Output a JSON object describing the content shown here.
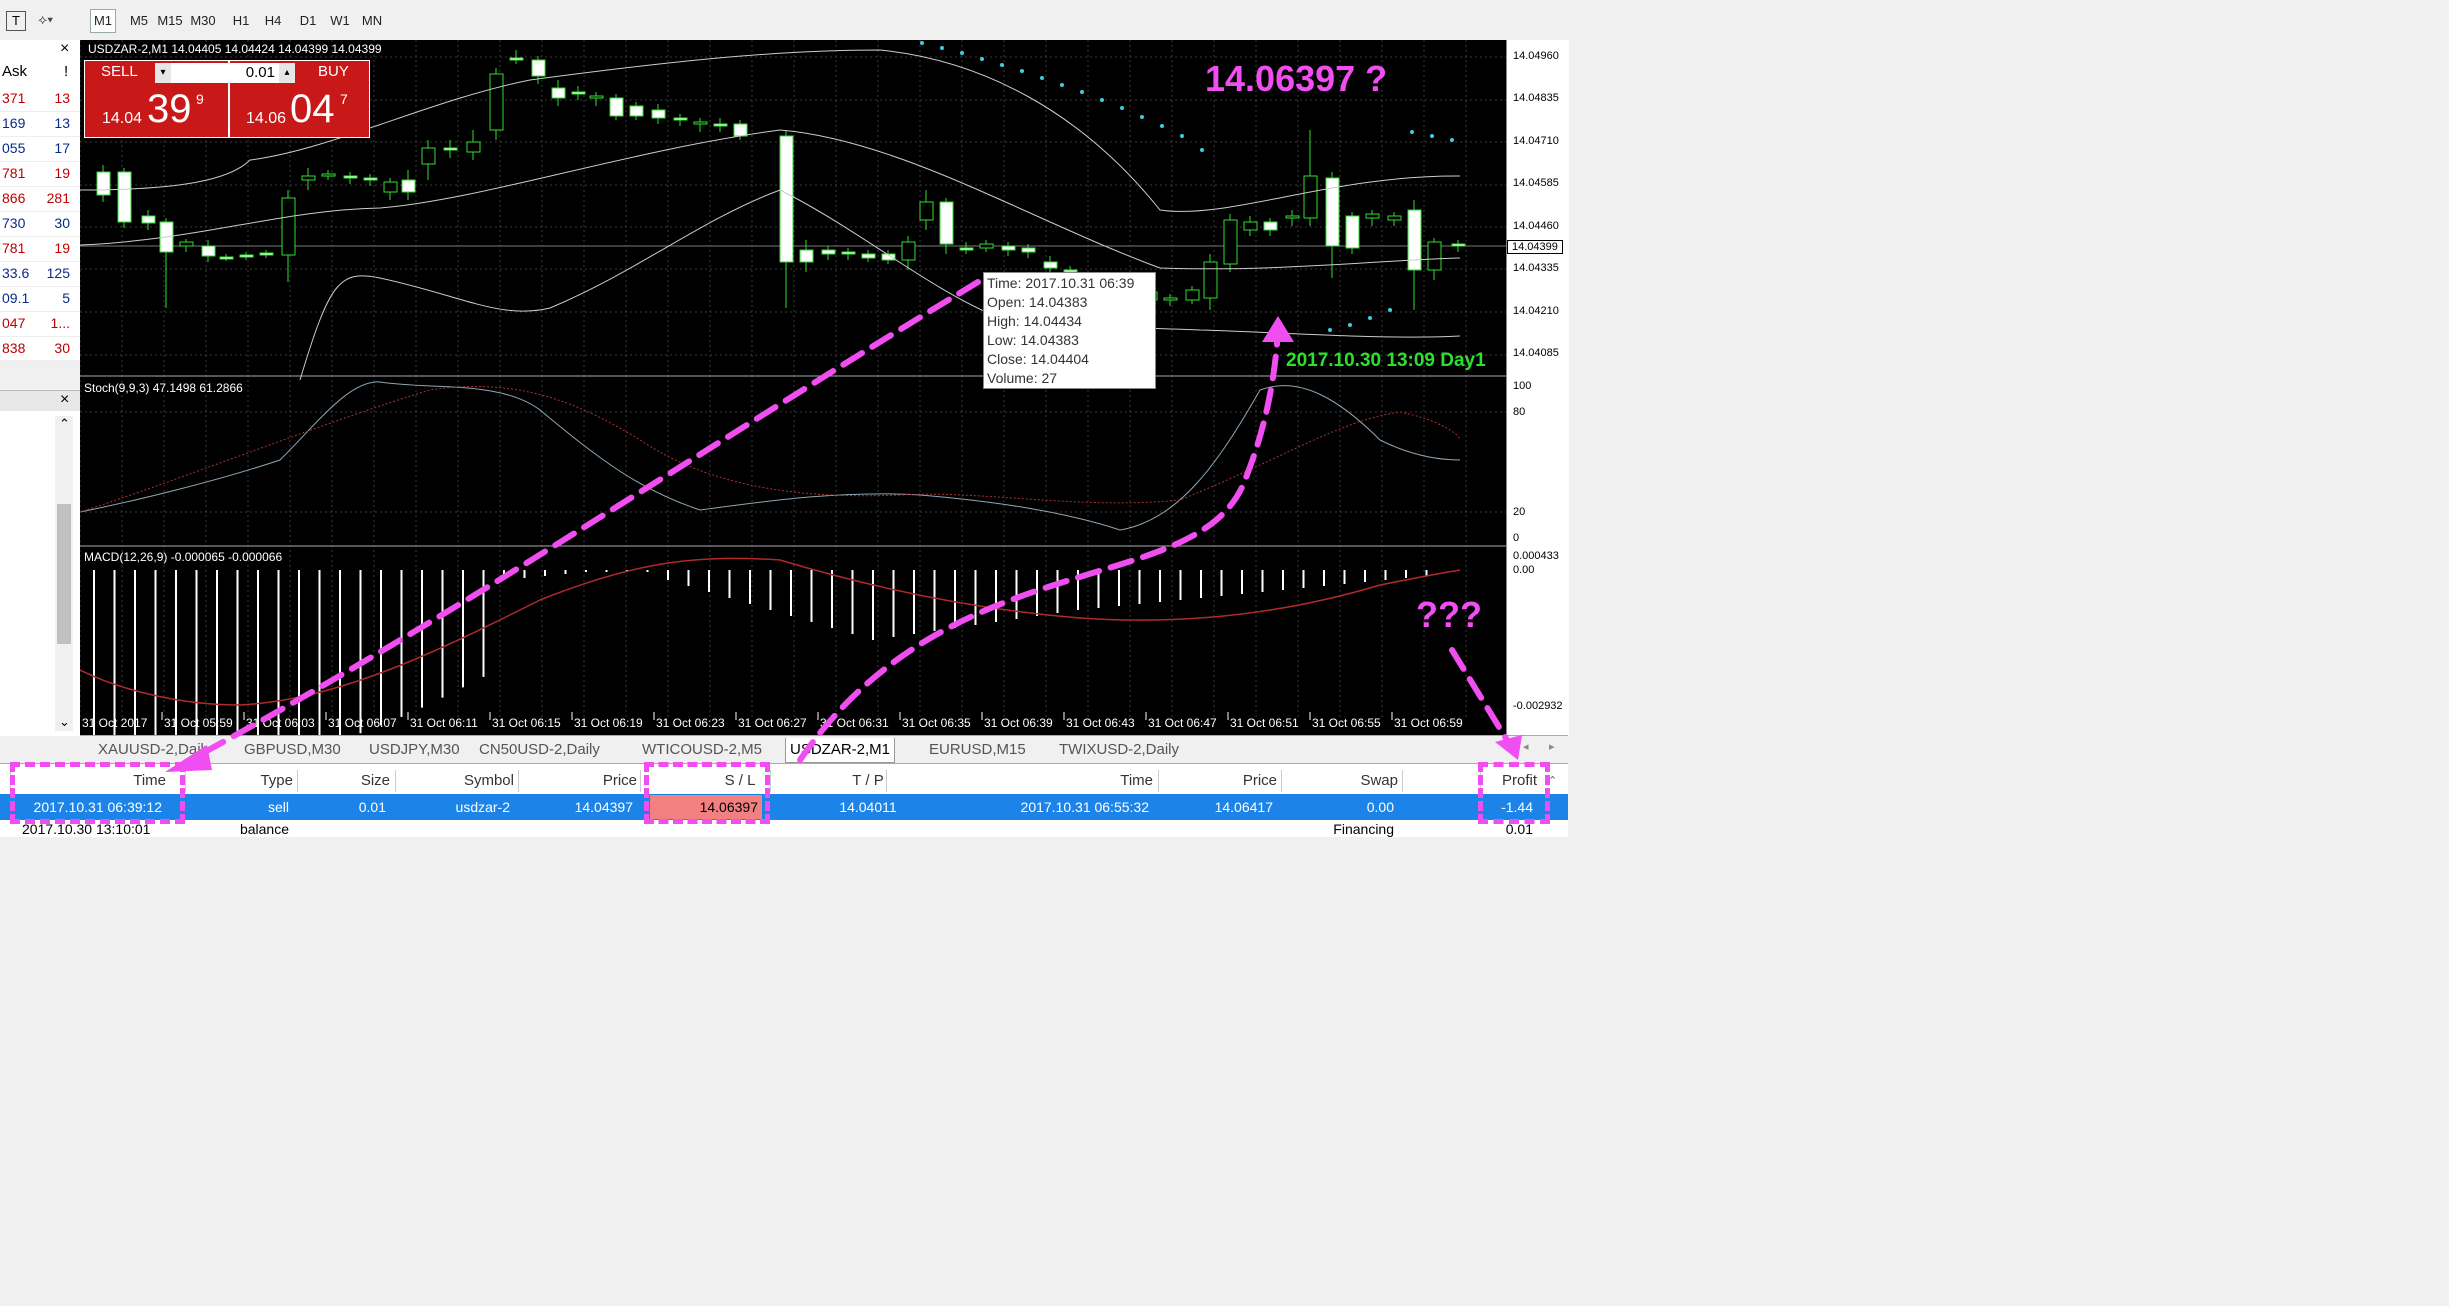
{
  "toolbar": {
    "timeframes": [
      "M1",
      "M5",
      "M15",
      "M30",
      "H1",
      "H4",
      "D1",
      "W1",
      "MN"
    ],
    "active": "M1"
  },
  "market_watch": {
    "header": {
      "ask": "Ask",
      "flag": "!"
    },
    "rows": [
      {
        "ask": "371",
        "spread": "13"
      },
      {
        "ask": "169",
        "spread": "13"
      },
      {
        "ask": "055",
        "spread": "17"
      },
      {
        "ask": "781",
        "spread": "19"
      },
      {
        "ask": "866",
        "spread": "281"
      },
      {
        "ask": "730",
        "spread": "30"
      },
      {
        "ask": "781",
        "spread": "19"
      },
      {
        "ask": "33.6",
        "spread": "125"
      },
      {
        "ask": "09.1",
        "spread": "5"
      },
      {
        "ask": "047",
        "spread": "1..."
      },
      {
        "ask": "838",
        "spread": "30"
      }
    ],
    "close": "×"
  },
  "navigator": {
    "close": "×",
    "up": "⌃",
    "down": "⌄"
  },
  "chart": {
    "header": "USDZAR-2,M1  14.04405 14.04424 14.04399 14.04399",
    "trade_panel": {
      "sell_label": "SELL",
      "buy_label": "BUY",
      "lot": "0.01",
      "sell_small": "14.04",
      "sell_big": "39",
      "sell_sup": "9",
      "buy_small": "14.06",
      "buy_big": "04",
      "buy_sup": "7"
    },
    "stoch_label": "Stoch(9,9,3) 47.1498 61.2866",
    "macd_label": "MACD(12,26,9) -0.000065 -0.000066",
    "tooltip": {
      "time": "Time: 2017.10.31 06:39",
      "open": "Open: 14.04383",
      "high": "High: 14.04434",
      "low": "Low:  14.04383",
      "close": "Close: 14.04404",
      "volume": "Volume: 27"
    },
    "time_labels": [
      "31 Oct 2017",
      "31 Oct 05:59",
      "31 Oct 06:03",
      "31 Oct 06:07",
      "31 Oct 06:11",
      "31 Oct 06:15",
      "31 Oct 06:19",
      "31 Oct 06:23",
      "31 Oct 06:27",
      "31 Oct 06:31",
      "31 Oct 06:35",
      "31 Oct 06:39",
      "31 Oct 06:43",
      "31 Oct 06:47",
      "31 Oct 06:51",
      "31 Oct 06:55",
      "31 Oct 06:59"
    ],
    "price_scale": [
      "14.04960",
      "14.04835",
      "14.04710",
      "14.04585",
      "14.04460",
      "14.04399",
      "14.04335",
      "14.04210",
      "14.04085"
    ],
    "current_price": "14.04399",
    "stoch_scale": [
      "100",
      "80",
      "20",
      "0"
    ],
    "macd_scale": [
      "0.000433",
      "0.00",
      "-0.002932"
    ]
  },
  "annotations": {
    "price_question": "14.06397 ?",
    "date_note": "2017.10.30 13:09 Day1",
    "profit_question": "???"
  },
  "tabs": [
    {
      "label": "XAUUSD-2,Daily"
    },
    {
      "label": "GBPUSD,M30"
    },
    {
      "label": "USDJPY,M30"
    },
    {
      "label": "CN50USD-2,Daily"
    },
    {
      "label": "WTICOUSD-2,M5"
    },
    {
      "label": "USDZAR-2,M1"
    },
    {
      "label": "EURUSD,M15"
    },
    {
      "label": "TWIXUSD-2,Daily"
    }
  ],
  "active_tab": "USDZAR-2,M1",
  "terminal": {
    "headers": {
      "time": "Time",
      "type": "Type",
      "size": "Size",
      "symbol": "Symbol",
      "price": "Price",
      "sl": "S / L",
      "tp": "T / P",
      "time2": "Time",
      "price2": "Price",
      "swap": "Swap",
      "profit": "Profit"
    },
    "row": {
      "time": "2017.10.31 06:39:12",
      "type": "sell",
      "size": "0.01",
      "symbol": "usdzar-2",
      "price": "14.04397",
      "sl": "14.06397",
      "tp": "14.04011",
      "time2": "2017.10.31 06:55:32",
      "price2": "14.06417",
      "swap": "0.00",
      "profit": "-1.44"
    },
    "row2": {
      "time": "2017.10.30 13:10:01",
      "type": "balance",
      "swap": "Financing",
      "profit": "0.01"
    }
  },
  "colors": {
    "annotation": "#f04ef0",
    "green_note": "#2ee02e",
    "selection": "#1c84e8",
    "sell_panel": "#c81818",
    "sl_highlight": "#f28080"
  }
}
